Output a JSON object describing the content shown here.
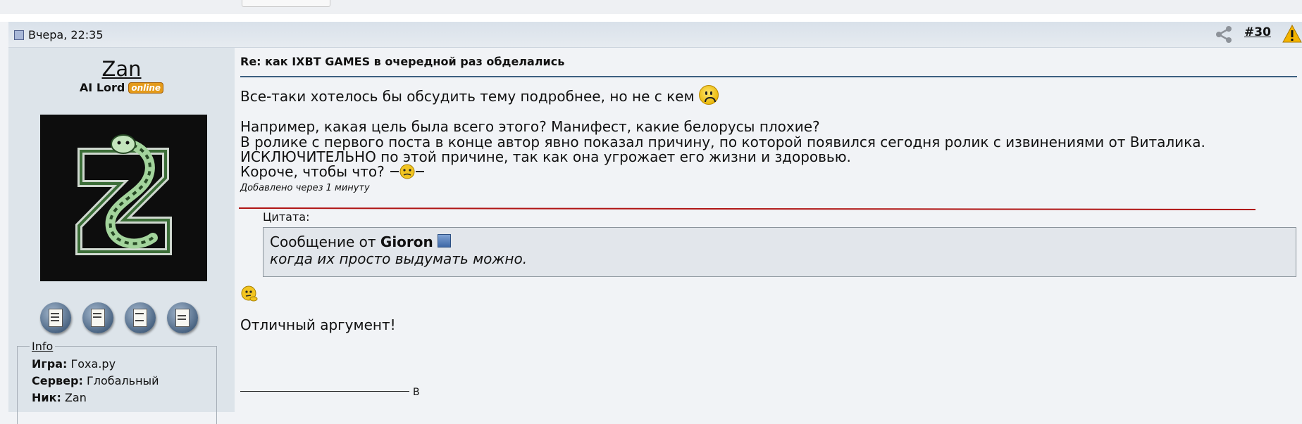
{
  "post": {
    "date": "Вчера, 22:35",
    "number": "#30"
  },
  "user": {
    "name": "Zan",
    "title": "AI Lord",
    "status_badge": "online",
    "info_legend": "Info",
    "info": [
      {
        "label": "Игра:",
        "value": "Гоха.ру"
      },
      {
        "label": "Сервер:",
        "value": "Глобальный"
      },
      {
        "label": "Ник:",
        "value": "Zan"
      }
    ]
  },
  "message": {
    "title": "Re: как IXBT GAMES в очередной раз обделались",
    "line1": "Все-таки хотелось бы обсудить тему подробнее, но не с кем",
    "line2": "Например, какая цель была всего этого? Манифест, какие белорусы плохие?",
    "line3": "В ролике с первого поста в конце автор явно показал причину, по которой появился сегодня ролик с извинениями от Виталика.",
    "line4": "ИСКЛЮЧИТЕЛЬНО по этой причине, так как она угрожает его жизни и здоровью.",
    "line5": "Короче, чтобы что?",
    "added_note": "Добавлено через 1 минуту",
    "quote_label": "Цитата:",
    "quote_from_prefix": "Сообщение от",
    "quote_author": "Gioron",
    "quote_text": "когда их просто выдумать можно.",
    "reply": "Отличный аргумент!",
    "signature_tail": "В"
  },
  "icons": {
    "share": "share-icon",
    "warning": "warning-icon",
    "post": "post-icon",
    "goto": "goto-post-icon"
  },
  "colors": {
    "header_bar": "#dfe6ed",
    "sidebar": "#dde4ea",
    "title_rule": "#3c5f80",
    "underline_red": "#b01414",
    "badge": "#e49a1a"
  }
}
